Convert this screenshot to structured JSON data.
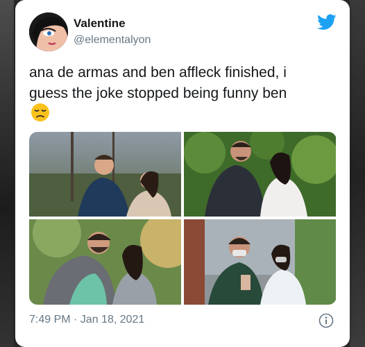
{
  "tweet": {
    "display_name": "Valentine",
    "handle": "@elementalyon",
    "text_line1": "ana de armas and ben affleck finished, i",
    "text_line2": "guess the joke stopped being funny ben",
    "timestamp": "7:49 PM · Jan 18, 2021"
  },
  "icons": {
    "brand": "twitter-bird-icon",
    "emoji": "disappointed-face-emoji",
    "info": "info-icon"
  },
  "media": {
    "photos": [
      {
        "name": "photo-1"
      },
      {
        "name": "photo-2"
      },
      {
        "name": "photo-3"
      },
      {
        "name": "photo-4"
      }
    ]
  },
  "colors": {
    "twitter_blue": "#1da1f2",
    "text_primary": "#14171a",
    "text_secondary": "#657786"
  }
}
